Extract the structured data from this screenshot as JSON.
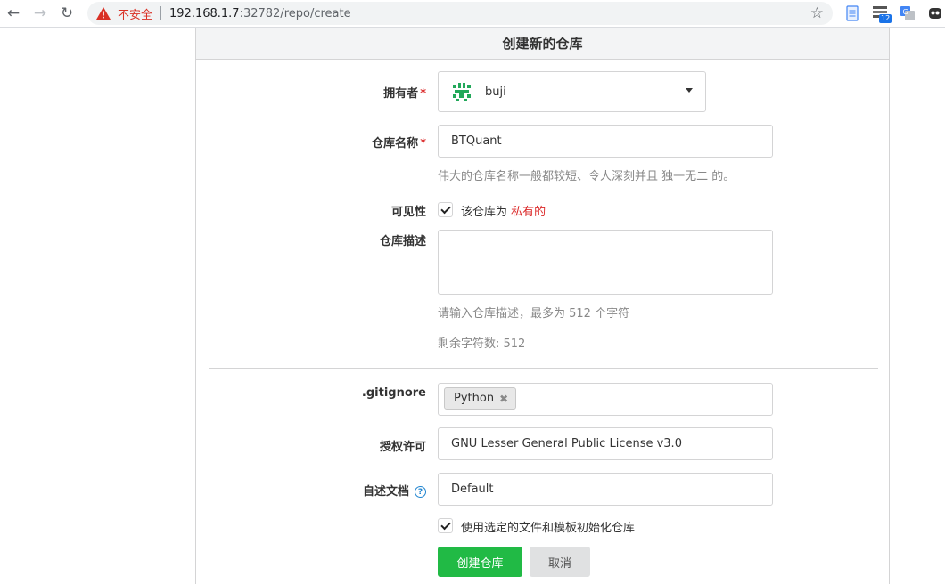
{
  "browser": {
    "warning_text": "不安全",
    "url_host": "192.168.1.7",
    "url_path": ":32782/repo/create",
    "extension_badge": "12"
  },
  "page": {
    "title": "创建新的仓库"
  },
  "form": {
    "owner": {
      "label": "拥有者",
      "value": "buji"
    },
    "repo_name": {
      "label": "仓库名称",
      "value": "BTQuant",
      "help": "伟大的仓库名称一般都较短、令人深刻并且 独一无二 的。"
    },
    "visibility": {
      "label": "可见性",
      "checkbox_text": "该仓库为 ",
      "private_text": "私有的",
      "checked": true
    },
    "description": {
      "label": "仓库描述",
      "value": "",
      "help": "请输入仓库描述，最多为 512 个字符",
      "remaining": "剩余字符数: 512"
    },
    "gitignore": {
      "label": ".gitignore",
      "selected": [
        "Python"
      ]
    },
    "license": {
      "label": "授权许可",
      "value": "GNU Lesser General Public License v3.0"
    },
    "readme": {
      "label": "自述文档",
      "value": "Default"
    },
    "auto_init": {
      "label": "使用选定的文件和模板初始化仓库",
      "checked": true
    }
  },
  "buttons": {
    "create": "创建仓库",
    "cancel": "取消"
  },
  "colors": {
    "primary": "#21ba45",
    "required": "#db2828",
    "private": "#db2828",
    "warning": "#d93025"
  }
}
